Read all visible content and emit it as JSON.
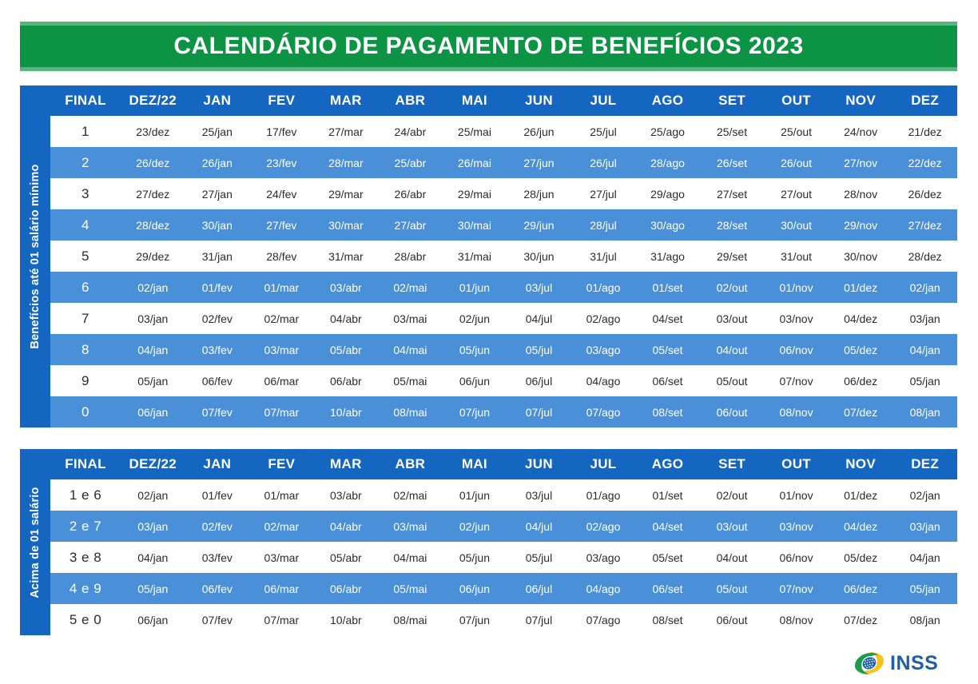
{
  "banner": {
    "title": "CALENDÁRIO DE PAGAMENTO DE BENEFÍCIOS 2023",
    "background_color": "#0c9444",
    "accent_color": "#56b67d"
  },
  "colors": {
    "header_blue": "#1566c0",
    "row_blue": "#4a90d9",
    "row_white": "#ffffff",
    "text_dark": "#2b2b2b",
    "logo_blue": "#1f5faa"
  },
  "columns": [
    "FINAL",
    "DEZ/22",
    "JAN",
    "FEV",
    "MAR",
    "ABR",
    "MAI",
    "JUN",
    "JUL",
    "AGO",
    "SET",
    "OUT",
    "NOV",
    "DEZ"
  ],
  "table_1": {
    "side_label": "Benefícios até 01 salário mínimo",
    "rows": [
      {
        "final": "1",
        "dates": [
          "23/dez",
          "25/jan",
          "17/fev",
          "27/mar",
          "24/abr",
          "25/mai",
          "26/jun",
          "25/jul",
          "25/ago",
          "25/set",
          "25/out",
          "24/nov",
          "21/dez"
        ]
      },
      {
        "final": "2",
        "dates": [
          "26/dez",
          "26/jan",
          "23/fev",
          "28/mar",
          "25/abr",
          "26/mai",
          "27/jun",
          "26/jul",
          "28/ago",
          "26/set",
          "26/out",
          "27/nov",
          "22/dez"
        ]
      },
      {
        "final": "3",
        "dates": [
          "27/dez",
          "27/jan",
          "24/fev",
          "29/mar",
          "26/abr",
          "29/mai",
          "28/jun",
          "27/jul",
          "29/ago",
          "27/set",
          "27/out",
          "28/nov",
          "26/dez"
        ]
      },
      {
        "final": "4",
        "dates": [
          "28/dez",
          "30/jan",
          "27/fev",
          "30/mar",
          "27/abr",
          "30/mai",
          "29/jun",
          "28/jul",
          "30/ago",
          "28/set",
          "30/out",
          "29/nov",
          "27/dez"
        ]
      },
      {
        "final": "5",
        "dates": [
          "29/dez",
          "31/jan",
          "28/fev",
          "31/mar",
          "28/abr",
          "31/mai",
          "30/jun",
          "31/jul",
          "31/ago",
          "29/set",
          "31/out",
          "30/nov",
          "28/dez"
        ]
      },
      {
        "final": "6",
        "dates": [
          "02/jan",
          "01/fev",
          "01/mar",
          "03/abr",
          "02/mai",
          "01/jun",
          "03/jul",
          "01/ago",
          "01/set",
          "02/out",
          "01/nov",
          "01/dez",
          "02/jan"
        ]
      },
      {
        "final": "7",
        "dates": [
          "03/jan",
          "02/fev",
          "02/mar",
          "04/abr",
          "03/mai",
          "02/jun",
          "04/jul",
          "02/ago",
          "04/set",
          "03/out",
          "03/nov",
          "04/dez",
          "03/jan"
        ]
      },
      {
        "final": "8",
        "dates": [
          "04/jan",
          "03/fev",
          "03/mar",
          "05/abr",
          "04/mai",
          "05/jun",
          "05/jul",
          "03/ago",
          "05/set",
          "04/out",
          "06/nov",
          "05/dez",
          "04/jan"
        ]
      },
      {
        "final": "9",
        "dates": [
          "05/jan",
          "06/fev",
          "06/mar",
          "06/abr",
          "05/mai",
          "06/jun",
          "06/jul",
          "04/ago",
          "06/set",
          "05/out",
          "07/nov",
          "06/dez",
          "05/jan"
        ]
      },
      {
        "final": "0",
        "dates": [
          "06/jan",
          "07/fev",
          "07/mar",
          "10/abr",
          "08/mai",
          "07/jun",
          "07/jul",
          "07/ago",
          "08/set",
          "06/out",
          "08/nov",
          "07/dez",
          "08/jan"
        ]
      }
    ]
  },
  "table_2": {
    "side_label": "Acima de 01 salário",
    "rows": [
      {
        "final": "1 e 6",
        "dates": [
          "02/jan",
          "01/fev",
          "01/mar",
          "03/abr",
          "02/mai",
          "01/jun",
          "03/jul",
          "01/ago",
          "01/set",
          "02/out",
          "01/nov",
          "01/dez",
          "02/jan"
        ]
      },
      {
        "final": "2 e 7",
        "dates": [
          "03/jan",
          "02/fev",
          "02/mar",
          "04/abr",
          "03/mai",
          "02/jun",
          "04/jul",
          "02/ago",
          "04/set",
          "03/out",
          "03/nov",
          "04/dez",
          "03/jan"
        ]
      },
      {
        "final": "3 e 8",
        "dates": [
          "04/jan",
          "03/fev",
          "03/mar",
          "05/abr",
          "04/mai",
          "05/jun",
          "05/jul",
          "03/ago",
          "05/set",
          "04/out",
          "06/nov",
          "05/dez",
          "04/jan"
        ]
      },
      {
        "final": "4 e 9",
        "dates": [
          "05/jan",
          "06/fev",
          "06/mar",
          "06/abr",
          "05/mai",
          "06/jun",
          "06/jul",
          "04/ago",
          "06/set",
          "05/out",
          "07/nov",
          "06/dez",
          "05/jan"
        ]
      },
      {
        "final": "5 e 0",
        "dates": [
          "06/jan",
          "07/fev",
          "07/mar",
          "10/abr",
          "08/mai",
          "07/jun",
          "07/jul",
          "07/ago",
          "08/set",
          "06/out",
          "08/nov",
          "07/dez",
          "08/jan"
        ]
      }
    ]
  },
  "logo": {
    "text": "INSS",
    "mark": "brazil-government-emblem-icon"
  }
}
